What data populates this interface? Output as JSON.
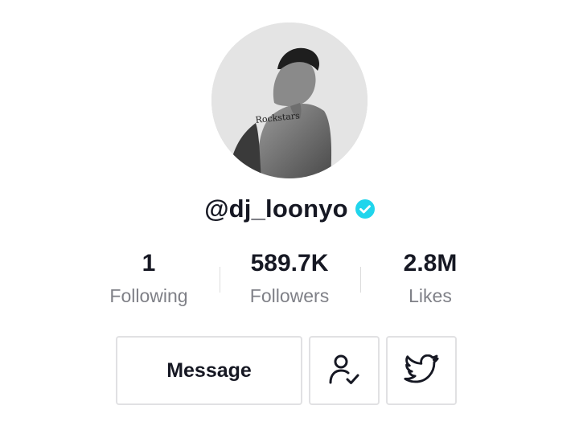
{
  "profile": {
    "username": "@dj_loonyo",
    "verified": true,
    "verified_color": "#20d5ec"
  },
  "stats": [
    {
      "value": "1",
      "label": "Following"
    },
    {
      "value": "589.7K",
      "label": "Followers"
    },
    {
      "value": "2.8M",
      "label": "Likes"
    }
  ],
  "actions": {
    "message_label": "Message",
    "follow_icon": "user-check-icon",
    "social_icon": "twitter-icon"
  },
  "colors": {
    "text_primary": "#161823",
    "text_secondary": "#7f8087",
    "border": "#e1e1e3"
  }
}
